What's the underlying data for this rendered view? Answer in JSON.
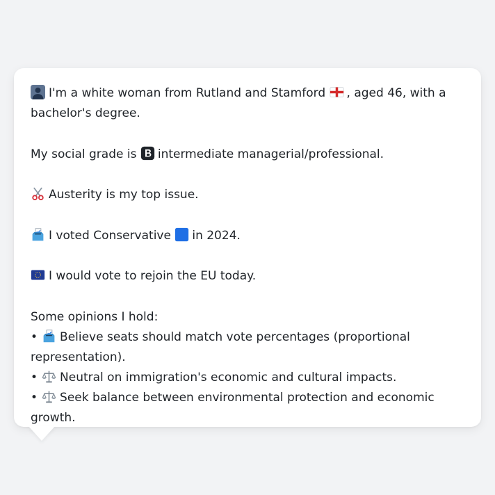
{
  "profile": {
    "intro_part1": "I'm a white woman from Rutland and Stamford",
    "intro_part2": ", aged 46, with a bachelor's degree.",
    "grade_part1": "My social grade is",
    "grade_part2": "intermediate managerial/professional.",
    "issue": "Austerity is my top issue.",
    "vote_part1": "I voted Conservative",
    "vote_part2": "in 2024.",
    "eu": "I would vote to rejoin the EU today.",
    "opinions_heading": "Some opinions I hold:",
    "opinions": [
      {
        "icon": "ballot-box-icon",
        "text": "Believe seats should match vote percentages (proportional representation)."
      },
      {
        "icon": "balance-scale-icon",
        "text": "Neutral on immigration's economic and cultural impacts."
      },
      {
        "icon": "balance-scale-icon",
        "text": "Seek balance between environmental protection and economic growth."
      }
    ],
    "bullet": "•"
  },
  "icons": {
    "person": "person-silhouette-icon",
    "flag": "england-flag-icon",
    "grade": "letter-b-icon",
    "issue": "scissors-icon",
    "ballot": "ballot-box-icon",
    "party": "blue-square-icon",
    "eu": "eu-flag-icon"
  },
  "colors": {
    "page_background": "#f2f3f5",
    "bubble_background": "#ffffff",
    "text": "#1f2328",
    "conservative_blue": "#1f6fe5",
    "eu_blue": "#1f3a93"
  }
}
